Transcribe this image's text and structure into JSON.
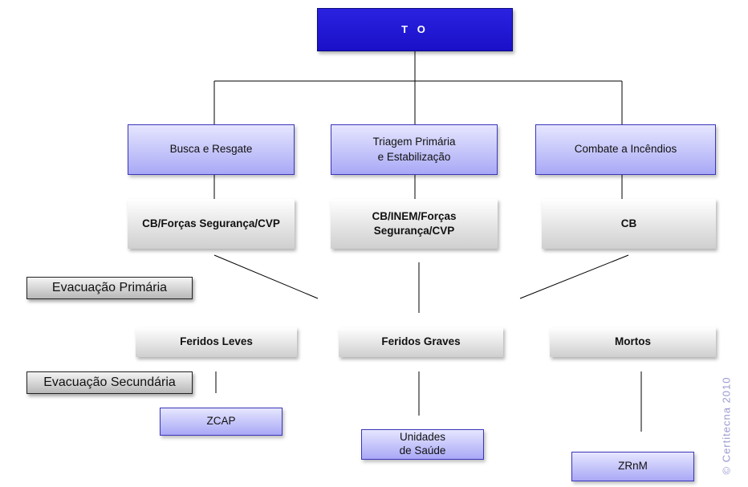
{
  "root": {
    "label": "T O"
  },
  "functions": [
    {
      "label_lines": [
        "Busca e Resgate"
      ],
      "agency_lines": [
        "CB/Forças Segurança/CVP"
      ]
    },
    {
      "label_lines": [
        "Triagem Primária",
        "e Estabilização"
      ],
      "agency_lines": [
        "CB/INEM/Forças",
        "Segurança/CVP"
      ]
    },
    {
      "label_lines": [
        "Combate a Incêndios"
      ],
      "agency_lines": [
        "CB"
      ]
    }
  ],
  "stages": {
    "primary": "Evacuação Primária",
    "secondary": "Evacuação Secundária"
  },
  "categories": [
    "Feridos Leves",
    "Feridos Graves",
    "Mortos"
  ],
  "destinations": [
    {
      "lines": [
        "ZCAP"
      ]
    },
    {
      "lines": [
        "Unidades",
        "de Saúde"
      ]
    },
    {
      "lines": [
        "ZRnM"
      ]
    }
  ],
  "copyright": "© Certitecna  2010",
  "colors": {
    "root": "#1f17d6",
    "function_box": "#b8b7f8",
    "agency_box": "#e6e6e6",
    "lines": "#000000"
  }
}
